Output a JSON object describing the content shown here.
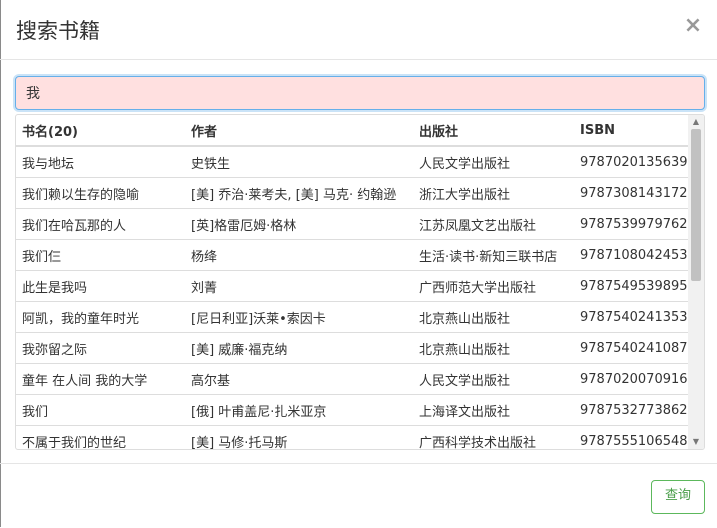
{
  "dialog": {
    "title": "搜索书籍",
    "close_label": "×"
  },
  "search": {
    "value": "我"
  },
  "table": {
    "headers": [
      "书名(20)",
      "作者",
      "出版社",
      "ISBN"
    ],
    "rows": [
      [
        "我与地坛",
        "史铁生",
        "人民文学出版社",
        "9787020135639"
      ],
      [
        "我们赖以生存的隐喻",
        "[美] 乔治·莱考夫, [美] 马克· 约翰逊",
        "浙江大学出版社",
        "9787308143172"
      ],
      [
        "我们在哈瓦那的人",
        "[英]格雷厄姆·格林",
        "江苏凤凰文艺出版社",
        "9787539979762"
      ],
      [
        "我们仨",
        "杨绛",
        "生活·读书·新知三联书店",
        "9787108042453"
      ],
      [
        "此生是我吗",
        "刘菁",
        "广西师范大学出版社",
        "9787549539895"
      ],
      [
        "阿凯，我的童年时光",
        "[尼日利亚]沃莱•索因卡",
        "北京燕山出版社",
        "9787540241353"
      ],
      [
        "我弥留之际",
        "[美] 威廉·福克纳",
        "北京燕山出版社",
        "9787540241087"
      ],
      [
        "童年 在人间 我的大学",
        "高尔基",
        "人民文学出版社",
        "9787020070916"
      ],
      [
        "我们",
        "[俄] 叶甫盖尼·扎米亚京",
        "上海译文出版社",
        "9787532773862"
      ],
      [
        "不属于我们的世纪",
        "[美] 马修·托马斯",
        "广西科学技术出版社",
        "9787555106548"
      ]
    ]
  },
  "footer": {
    "query_label": "查询"
  },
  "colors": {
    "input_bg": "#ffe0e0",
    "input_border": "#66afe9",
    "button_border": "#5cb85c"
  }
}
